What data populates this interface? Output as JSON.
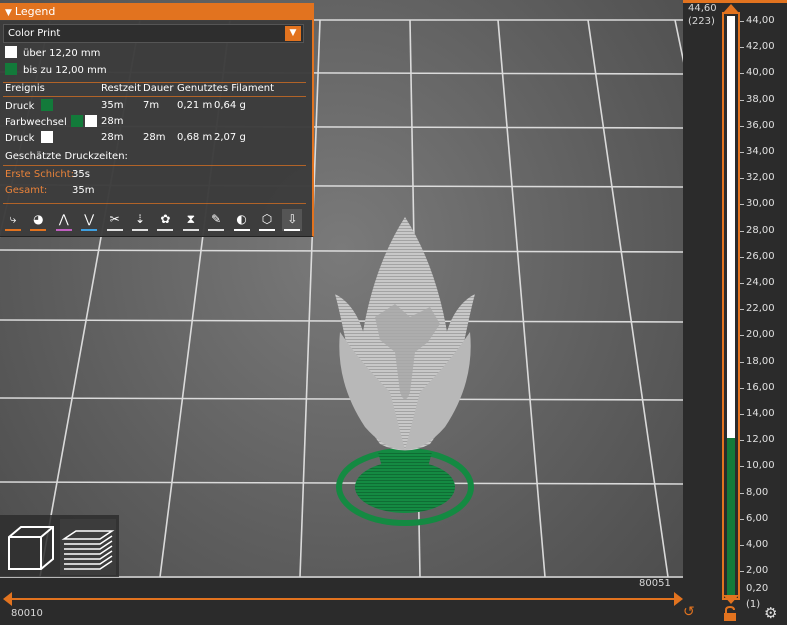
{
  "legend": {
    "title": "Legend",
    "view_type": "Color Print",
    "colors": [
      {
        "label": "über 12,20 mm",
        "color": "#ffffff"
      },
      {
        "label": "bis zu 12,00 mm",
        "color": "#137a3a"
      }
    ],
    "table": {
      "headers": [
        "Ereignis",
        "Restzeit",
        "Dauer",
        "Genutztes Filament"
      ],
      "rows": [
        {
          "event": "Druck",
          "swatches": [
            "#137a3a"
          ],
          "remaining": "35m",
          "duration": "7m",
          "length": "0,21 m",
          "weight": "0,64 g"
        },
        {
          "event": "Farbwechsel",
          "swatches": [
            "#137a3a",
            "#ffffff"
          ],
          "remaining": "28m",
          "duration": "",
          "length": "",
          "weight": ""
        },
        {
          "event": "Druck",
          "swatches": [
            "#ffffff"
          ],
          "remaining": "28m",
          "duration": "28m",
          "length": "0,68 m",
          "weight": "2,07 g"
        }
      ]
    },
    "estimated_label": "Geschätzte Druckzeiten:",
    "first_layer_label": "Erste Schicht:",
    "first_layer_value": "35s",
    "total_label": "Gesamt:",
    "total_value": "35m",
    "toolbar": [
      {
        "icon": "travel-icon",
        "accent": "#e2731f"
      },
      {
        "icon": "wipe-icon",
        "accent": "#e2731f"
      },
      {
        "icon": "retractions-icon",
        "accent": "#c060c0"
      },
      {
        "icon": "deretractions-icon",
        "accent": "#40a0e0"
      },
      {
        "icon": "seams-icon",
        "accent": "#e0e0e0"
      },
      {
        "icon": "tool-changes-icon",
        "accent": "#e0e0e0"
      },
      {
        "icon": "color-changes-icon",
        "accent": "#e0e0e0"
      },
      {
        "icon": "pause-prints-icon",
        "accent": "#e0e0e0"
      },
      {
        "icon": "custom-gcodes-icon",
        "accent": "#e0e0e0"
      },
      {
        "icon": "center-of-gravity-icon",
        "accent": "#ffffff"
      },
      {
        "icon": "shells-icon",
        "accent": "#ffffff"
      },
      {
        "icon": "tool-marker-icon",
        "accent": "#ffffff"
      }
    ]
  },
  "horizontal_slider": {
    "left_value": "80010",
    "right_value": "80051"
  },
  "vertical_slider": {
    "top_value": "44,60",
    "top_layer": "(223)",
    "bottom_value": "0,20",
    "bottom_layer": "(1)",
    "color_change_at": 12.0,
    "max": 44.6,
    "ticks": [
      "44,00",
      "42,00",
      "40,00",
      "38,00",
      "36,00",
      "34,00",
      "32,00",
      "30,00",
      "28,00",
      "26,00",
      "24,00",
      "22,00",
      "20,00",
      "18,00",
      "16,00",
      "14,00",
      "12,00",
      "10,00",
      "8,00",
      "6,00",
      "4,00",
      "2,00"
    ]
  },
  "colors": {
    "accent": "#e2731f",
    "green": "#137a3a",
    "white": "#ffffff"
  }
}
